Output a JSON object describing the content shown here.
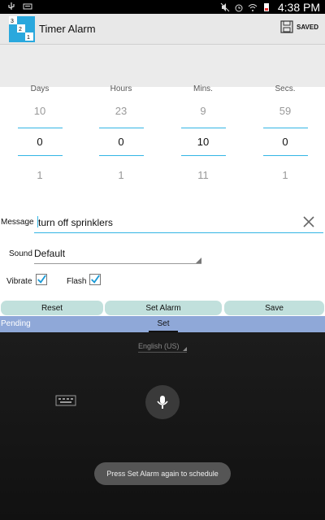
{
  "status_bar": {
    "time": "4:38 PM",
    "colors": {
      "background": "#000000"
    }
  },
  "action_bar": {
    "title": "Timer Alarm",
    "saved_label": "SAVED",
    "app_icon_digits": [
      "3",
      "2",
      "1"
    ]
  },
  "pickers": [
    {
      "label": "Days",
      "prev": "10",
      "current": "0",
      "next": "1"
    },
    {
      "label": "Hours",
      "prev": "23",
      "current": "0",
      "next": "1"
    },
    {
      "label": "Mins.",
      "prev": "9",
      "current": "10",
      "next": "11"
    },
    {
      "label": "Secs.",
      "prev": "59",
      "current": "0",
      "next": "1"
    }
  ],
  "message": {
    "label": "Message",
    "value": "turn off sprinklers"
  },
  "sound": {
    "label": "Sound",
    "value": "Default"
  },
  "checkboxes": [
    {
      "label": "Vibrate",
      "checked": true
    },
    {
      "label": "Flash",
      "checked": true
    }
  ],
  "buttons": {
    "reset": "Reset",
    "set_alarm": "Set Alarm",
    "save": "Save"
  },
  "tabs": {
    "pending": "Pending",
    "set": "Set"
  },
  "voice_input": {
    "language": "English (US)",
    "toast": "Press Set Alarm again to schedule"
  },
  "colors": {
    "accent": "#33b5e5",
    "button_bg": "#c1e0dc",
    "strip_bg": "#8fa8d8",
    "checkbox": "#1a9ad6"
  }
}
